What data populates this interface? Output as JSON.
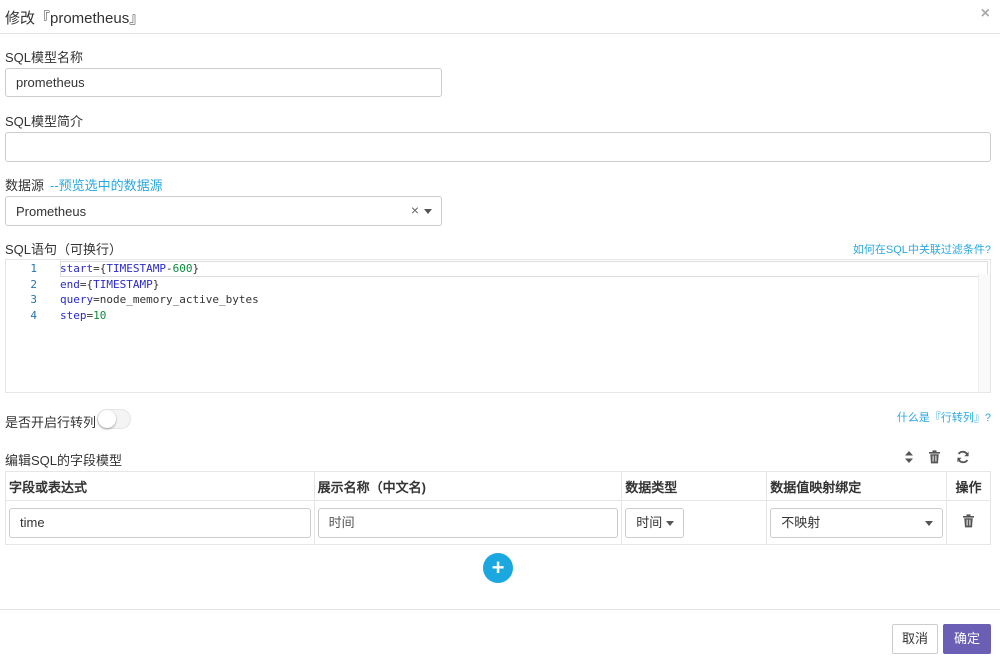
{
  "dialog": {
    "title": "修改『prometheus』",
    "close": "×"
  },
  "model_name": {
    "label": "SQL模型名称",
    "value": "prometheus"
  },
  "model_desc": {
    "label": "SQL模型简介",
    "value": ""
  },
  "datasource": {
    "label": "数据源",
    "preview_link": "--预览选中的数据源",
    "value": "Prometheus",
    "clear": "×"
  },
  "sql": {
    "label": "SQL语句（可换行）",
    "help_link": "如何在SQL中关联过滤条件?",
    "lines": [
      {
        "num": "1",
        "key": "start",
        "eq": "={",
        "val": "TIMESTAMP",
        "op": "-",
        "num_val": "600",
        "tail": "}"
      },
      {
        "num": "2",
        "key": "end",
        "eq": "={",
        "val": "TIMESTAMP",
        "tail": "}"
      },
      {
        "num": "3",
        "key": "query",
        "eq": "=",
        "plain": "node_memory_active_bytes"
      },
      {
        "num": "4",
        "key": "step",
        "eq": "=",
        "num_val": "10"
      }
    ]
  },
  "pivot": {
    "label": "是否开启行转列",
    "help_link": "什么是『行转列』?",
    "enabled": false
  },
  "fields": {
    "label": "编辑SQL的字段模型",
    "headers": [
      "字段或表达式",
      "展示名称（中文名)",
      "数据类型",
      "数据值映射绑定",
      "操作"
    ],
    "rows": [
      {
        "field": "time",
        "display_placeholder": "时间",
        "type": "时间",
        "mapping": "不映射"
      }
    ]
  },
  "icons": {
    "sort": "sort-icon",
    "trash": "trash-icon",
    "refresh": "refresh-icon",
    "add": "plus-icon"
  },
  "footer": {
    "cancel": "取消",
    "ok": "确定"
  },
  "colors": {
    "accent": "#1ba8e0",
    "primary": "#6b5fb5",
    "link": "#2aa8e0"
  }
}
